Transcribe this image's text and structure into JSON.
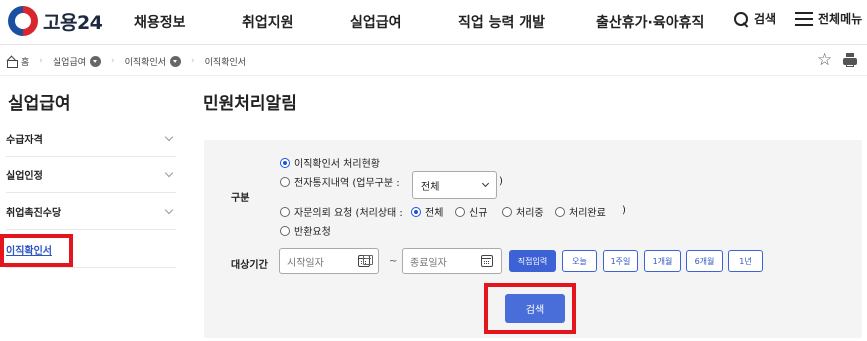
{
  "header": {
    "logo_text": "고용24",
    "nav": [
      "채용정보",
      "취업지원",
      "실업급여",
      "직업 능력 개발",
      "출산휴가·육아휴직"
    ],
    "search_label": "검색",
    "menu_label": "전체메뉴"
  },
  "breadcrumb": {
    "home": "홈",
    "items": [
      "실업급여",
      "이직확인서",
      "이직확인서"
    ]
  },
  "sidebar": {
    "title": "실업급여",
    "items": [
      {
        "label": "수급자격"
      },
      {
        "label": "실업인정"
      },
      {
        "label": "취업촉진수당"
      },
      {
        "label": "이직확인서"
      }
    ]
  },
  "main": {
    "title": "민원처리알림",
    "category_label": "구분",
    "options": {
      "status": "이직확인서 처리현황",
      "edoc": "전자통지내역 (업무구분 :",
      "consult": "자문의뢰 요청 (처리상태 :",
      "return": "반환요청"
    },
    "work_select_value": "전체",
    "close_paren": ")",
    "process_states": [
      "전체",
      "신규",
      "처리중",
      "처리완료"
    ],
    "period_label": "대상기간",
    "start_placeholder": "시작일자",
    "end_placeholder": "종료일자",
    "tilde": "~",
    "period_buttons": [
      "직접입력",
      "오늘",
      "1주일",
      "1개월",
      "6개월",
      "1년"
    ],
    "search_button": "검색"
  },
  "colors": {
    "accent": "#3d62d6",
    "highlight": "#e4151c",
    "active_link": "#2f55c4"
  }
}
